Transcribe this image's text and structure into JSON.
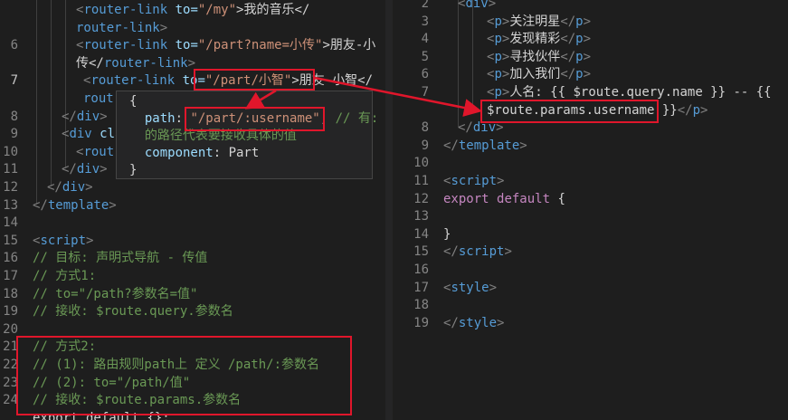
{
  "left_editor": {
    "lines": [
      {
        "n": "",
        "tokens": [
          {
            "t": "<",
            "c": "punc"
          },
          {
            "t": "router-link",
            "c": "tag"
          },
          {
            "t": " to=",
            "c": "attr"
          },
          {
            "t": "\"/my\"",
            "c": "str"
          },
          {
            "t": ">我的音乐</",
            "c": "txt"
          }
        ]
      },
      {
        "n": "",
        "tokens": [
          {
            "t": "router-link",
            "c": "tag"
          },
          {
            "t": ">",
            "c": "punc"
          }
        ]
      },
      {
        "n": "6",
        "tokens": [
          {
            "t": "<",
            "c": "punc"
          },
          {
            "t": "router-link",
            "c": "tag"
          },
          {
            "t": " to=",
            "c": "attr"
          },
          {
            "t": "\"/part?name=小传\"",
            "c": "str"
          },
          {
            "t": ">朋友-小",
            "c": "txt"
          }
        ]
      },
      {
        "n": "",
        "tokens": [
          {
            "t": "传</",
            "c": "txt"
          },
          {
            "t": "router-link",
            "c": "tag"
          },
          {
            "t": ">",
            "c": "punc"
          }
        ]
      },
      {
        "n": "7",
        "tokens": [
          {
            "t": "<",
            "c": "punc"
          },
          {
            "t": "router-link",
            "c": "tag"
          },
          {
            "t": " to=",
            "c": "attr"
          },
          {
            "t": "\"/part/小智\"",
            "c": "str"
          },
          {
            "t": ">朋友-小智</",
            "c": "txt"
          }
        ]
      },
      {
        "n": "",
        "tokens": [
          {
            "t": "rout",
            "c": "tag"
          }
        ]
      },
      {
        "n": "8",
        "tokens": [
          {
            "t": "</",
            "c": "punc"
          },
          {
            "t": "div",
            "c": "tag"
          },
          {
            "t": ">",
            "c": "punc"
          }
        ]
      },
      {
        "n": "9",
        "tokens": [
          {
            "t": "<",
            "c": "punc"
          },
          {
            "t": "div",
            "c": "tag"
          },
          {
            "t": " cla",
            "c": "attr"
          }
        ]
      },
      {
        "n": "10",
        "tokens": [
          {
            "t": "<",
            "c": "punc"
          },
          {
            "t": "rout",
            "c": "tag"
          }
        ]
      },
      {
        "n": "11",
        "tokens": [
          {
            "t": "</",
            "c": "punc"
          },
          {
            "t": "div",
            "c": "tag"
          },
          {
            "t": ">",
            "c": "punc"
          }
        ]
      },
      {
        "n": "12",
        "tokens": [
          {
            "t": "</",
            "c": "punc"
          },
          {
            "t": "div",
            "c": "tag"
          },
          {
            "t": ">",
            "c": "punc"
          }
        ]
      },
      {
        "n": "13",
        "tokens": [
          {
            "t": "</",
            "c": "punc"
          },
          {
            "t": "template",
            "c": "tag"
          },
          {
            "t": ">",
            "c": "punc"
          }
        ]
      },
      {
        "n": "14",
        "tokens": []
      },
      {
        "n": "15",
        "tokens": [
          {
            "t": "<",
            "c": "punc"
          },
          {
            "t": "script",
            "c": "tag"
          },
          {
            "t": ">",
            "c": "punc"
          }
        ]
      },
      {
        "n": "16",
        "tokens": [
          {
            "t": "// 目标: 声明式导航 - 传值",
            "c": "cmt"
          }
        ]
      },
      {
        "n": "17",
        "tokens": [
          {
            "t": "// 方式1:",
            "c": "cmt"
          }
        ]
      },
      {
        "n": "18",
        "tokens": [
          {
            "t": "// to=\"/path?参数名=值\"",
            "c": "cmt"
          }
        ]
      },
      {
        "n": "19",
        "tokens": [
          {
            "t": "// 接收: $route.query.参数名",
            "c": "cmt"
          }
        ]
      },
      {
        "n": "20",
        "tokens": []
      },
      {
        "n": "21",
        "tokens": [
          {
            "t": "// 方式2:",
            "c": "cmt"
          }
        ]
      },
      {
        "n": "22",
        "tokens": [
          {
            "t": "// (1): 路由规则path上 定义 /path/:参数名",
            "c": "cmt"
          }
        ]
      },
      {
        "n": "23",
        "tokens": [
          {
            "t": "// (2): to=\"/path/值\"",
            "c": "cmt"
          }
        ]
      },
      {
        "n": "24",
        "tokens": [
          {
            "t": "// 接收: $route.params.参数名",
            "c": "cmt"
          }
        ]
      },
      {
        "n": "",
        "tokens": [
          {
            "t": "export default {};",
            "c": "txt"
          }
        ]
      }
    ]
  },
  "hover_popup": {
    "lines": [
      [
        {
          "t": "{",
          "c": "txt"
        }
      ],
      [
        {
          "t": "  path",
          "c": "key"
        },
        {
          "t": ": ",
          "c": "txt"
        },
        {
          "t": "\"/part/:username\"",
          "c": "str"
        },
        {
          "t": ", ",
          "c": "txt"
        },
        {
          "t": "// 有:",
          "c": "cmt"
        }
      ],
      [
        {
          "t": "  的路径代表要接收具体的值",
          "c": "cmt"
        }
      ],
      [
        {
          "t": "  component",
          "c": "key"
        },
        {
          "t": ": Part",
          "c": "txt"
        }
      ],
      [
        {
          "t": "}",
          "c": "txt"
        }
      ]
    ]
  },
  "right_editor": {
    "lines": [
      {
        "n": "2",
        "tokens": [
          {
            "t": "<",
            "c": "punc"
          },
          {
            "t": "div",
            "c": "tag"
          },
          {
            "t": ">",
            "c": "punc"
          }
        ]
      },
      {
        "n": "3",
        "tokens": [
          {
            "t": "<",
            "c": "punc"
          },
          {
            "t": "p",
            "c": "tag"
          },
          {
            "t": ">",
            "c": "punc"
          },
          {
            "t": "关注明星",
            "c": "txt"
          },
          {
            "t": "</",
            "c": "punc"
          },
          {
            "t": "p",
            "c": "tag"
          },
          {
            "t": ">",
            "c": "punc"
          }
        ]
      },
      {
        "n": "4",
        "tokens": [
          {
            "t": "<",
            "c": "punc"
          },
          {
            "t": "p",
            "c": "tag"
          },
          {
            "t": ">",
            "c": "punc"
          },
          {
            "t": "发现精彩",
            "c": "txt"
          },
          {
            "t": "</",
            "c": "punc"
          },
          {
            "t": "p",
            "c": "tag"
          },
          {
            "t": ">",
            "c": "punc"
          }
        ]
      },
      {
        "n": "5",
        "tokens": [
          {
            "t": "<",
            "c": "punc"
          },
          {
            "t": "p",
            "c": "tag"
          },
          {
            "t": ">",
            "c": "punc"
          },
          {
            "t": "寻找伙伴",
            "c": "txt"
          },
          {
            "t": "</",
            "c": "punc"
          },
          {
            "t": "p",
            "c": "tag"
          },
          {
            "t": ">",
            "c": "punc"
          }
        ]
      },
      {
        "n": "6",
        "tokens": [
          {
            "t": "<",
            "c": "punc"
          },
          {
            "t": "p",
            "c": "tag"
          },
          {
            "t": ">",
            "c": "punc"
          },
          {
            "t": "加入我们",
            "c": "txt"
          },
          {
            "t": "</",
            "c": "punc"
          },
          {
            "t": "p",
            "c": "tag"
          },
          {
            "t": ">",
            "c": "punc"
          }
        ]
      },
      {
        "n": "7",
        "tokens": [
          {
            "t": "<",
            "c": "punc"
          },
          {
            "t": "p",
            "c": "tag"
          },
          {
            "t": ">",
            "c": "punc"
          },
          {
            "t": "人名: {{ $route.query.name }} -- {{",
            "c": "txt"
          }
        ]
      },
      {
        "n": "",
        "tokens": [
          {
            "t": "$route.params.username",
            "c": "txt"
          },
          {
            "t": " }}",
            "c": "txt"
          },
          {
            "t": "</",
            "c": "punc"
          },
          {
            "t": "p",
            "c": "tag"
          },
          {
            "t": ">",
            "c": "punc"
          }
        ]
      },
      {
        "n": "8",
        "tokens": [
          {
            "t": "</",
            "c": "punc"
          },
          {
            "t": "div",
            "c": "tag"
          },
          {
            "t": ">",
            "c": "punc"
          }
        ]
      },
      {
        "n": "9",
        "tokens": [
          {
            "t": "</",
            "c": "punc"
          },
          {
            "t": "template",
            "c": "tag"
          },
          {
            "t": ">",
            "c": "punc"
          }
        ]
      },
      {
        "n": "10",
        "tokens": []
      },
      {
        "n": "11",
        "tokens": [
          {
            "t": "<",
            "c": "punc"
          },
          {
            "t": "script",
            "c": "tag"
          },
          {
            "t": ">",
            "c": "punc"
          }
        ]
      },
      {
        "n": "12",
        "tokens": [
          {
            "t": "export",
            "c": "kw"
          },
          {
            "t": " ",
            "c": "txt"
          },
          {
            "t": "default",
            "c": "kw"
          },
          {
            "t": " {",
            "c": "txt"
          }
        ]
      },
      {
        "n": "13",
        "tokens": []
      },
      {
        "n": "14",
        "tokens": [
          {
            "t": "}",
            "c": "txt"
          }
        ]
      },
      {
        "n": "15",
        "tokens": [
          {
            "t": "</",
            "c": "punc"
          },
          {
            "t": "script",
            "c": "tag"
          },
          {
            "t": ">",
            "c": "punc"
          }
        ]
      },
      {
        "n": "16",
        "tokens": []
      },
      {
        "n": "17",
        "tokens": [
          {
            "t": "<",
            "c": "punc"
          },
          {
            "t": "style",
            "c": "tag"
          },
          {
            "t": ">",
            "c": "punc"
          }
        ]
      },
      {
        "n": "18",
        "tokens": []
      },
      {
        "n": "19",
        "tokens": [
          {
            "t": "</",
            "c": "punc"
          },
          {
            "t": "style",
            "c": "tag"
          },
          {
            "t": ">",
            "c": "punc"
          }
        ]
      }
    ]
  },
  "annotation": {
    "color": "#e0162b"
  }
}
